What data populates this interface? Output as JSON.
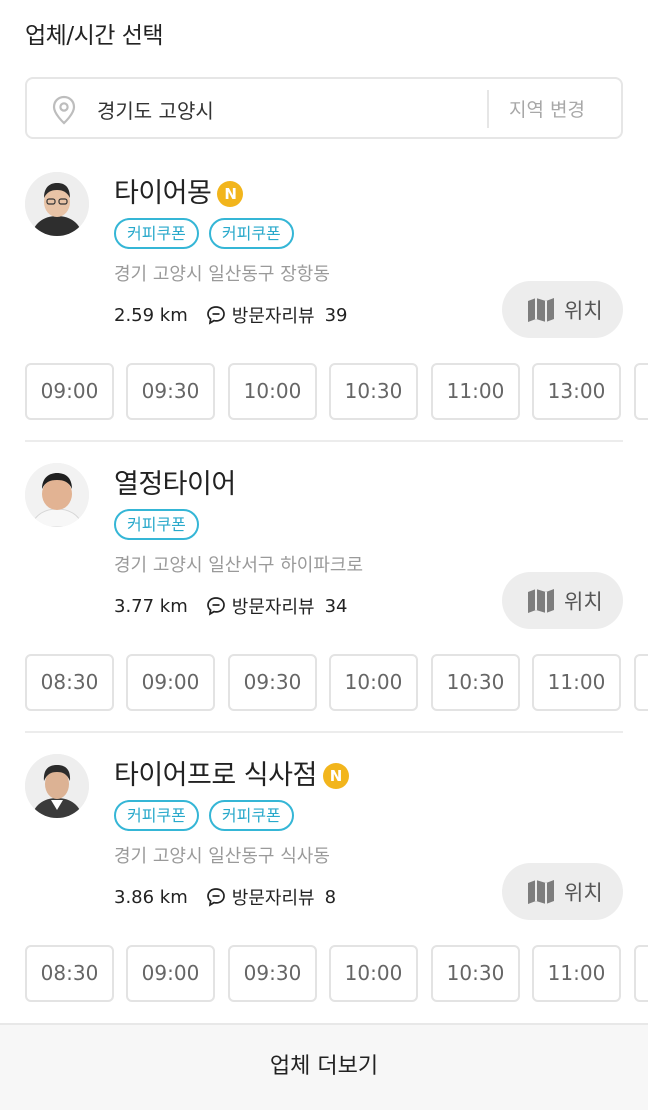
{
  "header": {
    "title": "업체/시간 선택"
  },
  "region": {
    "current": "경기도 고양시",
    "change_label": "지역 변경"
  },
  "shops": [
    {
      "name": "타이어몽",
      "badge": "N",
      "coupons": [
        "커피쿠폰",
        "커피쿠폰"
      ],
      "address": "경기 고양시 일산동구 장항동",
      "distance": "2.59 km",
      "review_label": "방문자리뷰",
      "review_count": "39",
      "location_label": "위치",
      "times": [
        "09:00",
        "09:30",
        "10:00",
        "10:30",
        "11:00",
        "13:00"
      ]
    },
    {
      "name": "열정타이어",
      "badge": "",
      "coupons": [
        "커피쿠폰"
      ],
      "address": "경기 고양시 일산서구 하이파크로",
      "distance": "3.77 km",
      "review_label": "방문자리뷰",
      "review_count": "34",
      "location_label": "위치",
      "times": [
        "08:30",
        "09:00",
        "09:30",
        "10:00",
        "10:30",
        "11:00"
      ]
    },
    {
      "name": "타이어프로 식사점",
      "badge": "N",
      "coupons": [
        "커피쿠폰",
        "커피쿠폰"
      ],
      "address": "경기 고양시 일산동구 식사동",
      "distance": "3.86 km",
      "review_label": "방문자리뷰",
      "review_count": "8",
      "location_label": "위치",
      "times": [
        "08:30",
        "09:00",
        "09:30",
        "10:00",
        "10:30",
        "11:00"
      ]
    }
  ],
  "footer": {
    "more_label": "업체 더보기"
  },
  "colors": {
    "accent_coupon": "#35b6d6",
    "badge_new": "#f2b51c",
    "location_button_bg": "#ededed"
  },
  "icons": {
    "region": "map-pin-icon",
    "review": "speech-bubble-icon",
    "location": "folded-map-icon"
  }
}
